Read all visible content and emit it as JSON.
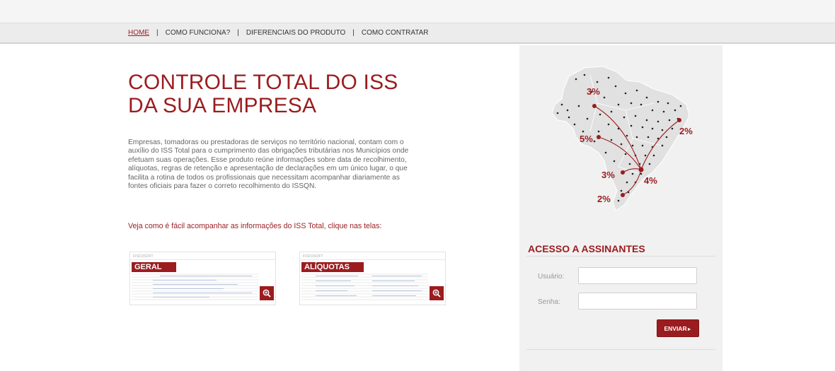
{
  "nav": {
    "items": [
      {
        "label": "HOME"
      },
      {
        "label": "COMO FUNCIONA?"
      },
      {
        "label": "DIFERENCIAIS DO PRODUTO"
      },
      {
        "label": "COMO CONTRATAR"
      }
    ],
    "separator": "|"
  },
  "hero": {
    "title_line1": "CONTROLE TOTAL DO ISS",
    "title_line2": "DA SUA EMPRESA",
    "description": "Empresas, tomadoras ou prestadoras de serviços no território nacional, contam com o auxílio do ISS Total para o cumprimento das obrigações tributárias nos Municípios onde efetuam suas operações. Esse produto reúne informações sobre data de recolhimento, alíquotas, regras de retenção e apresentação de declarações em um único lugar, o que facilita a rotina de todos os profissionais que necessitam acompanhar diariamente as fontes oficiais para fazer o correto recolhimento do ISSQN.",
    "cta": "Veja como é fácil acompanhar as informações do ISS Total, clique nas telas:"
  },
  "thumbnails": [
    {
      "badge": "GERAL",
      "brand": "FISCOSOFT",
      "icon": "zoom-in-icon"
    },
    {
      "badge": "ALÍQUOTAS",
      "brand": "FISCOSOFT",
      "icon": "zoom-in-icon"
    }
  ],
  "map": {
    "labels": [
      "3%",
      "5%",
      "2%",
      "3%",
      "4%",
      "2%"
    ]
  },
  "access": {
    "title": "ACESSO A ASSINANTES",
    "user_label": "Usuário:",
    "user_value": "",
    "password_label": "Senha:",
    "password_value": "",
    "submit_label": "ENVIAR"
  },
  "colors": {
    "accent": "#9b1c1f",
    "nav_bg": "#ececec",
    "sidebar_bg": "#f1f1f1"
  }
}
